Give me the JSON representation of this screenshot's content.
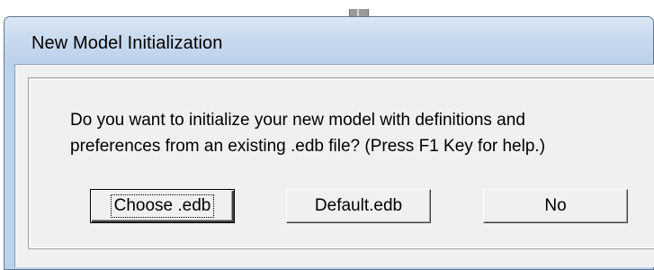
{
  "dialog": {
    "title": "New Model Initialization",
    "message": "Do you want to initialize your new model with definitions and\npreferences from an existing .edb file? (Press F1 Key for help.)",
    "buttons": {
      "choose_label": "Choose .edb",
      "default_label": "Default.edb",
      "no_label": "No"
    }
  }
}
